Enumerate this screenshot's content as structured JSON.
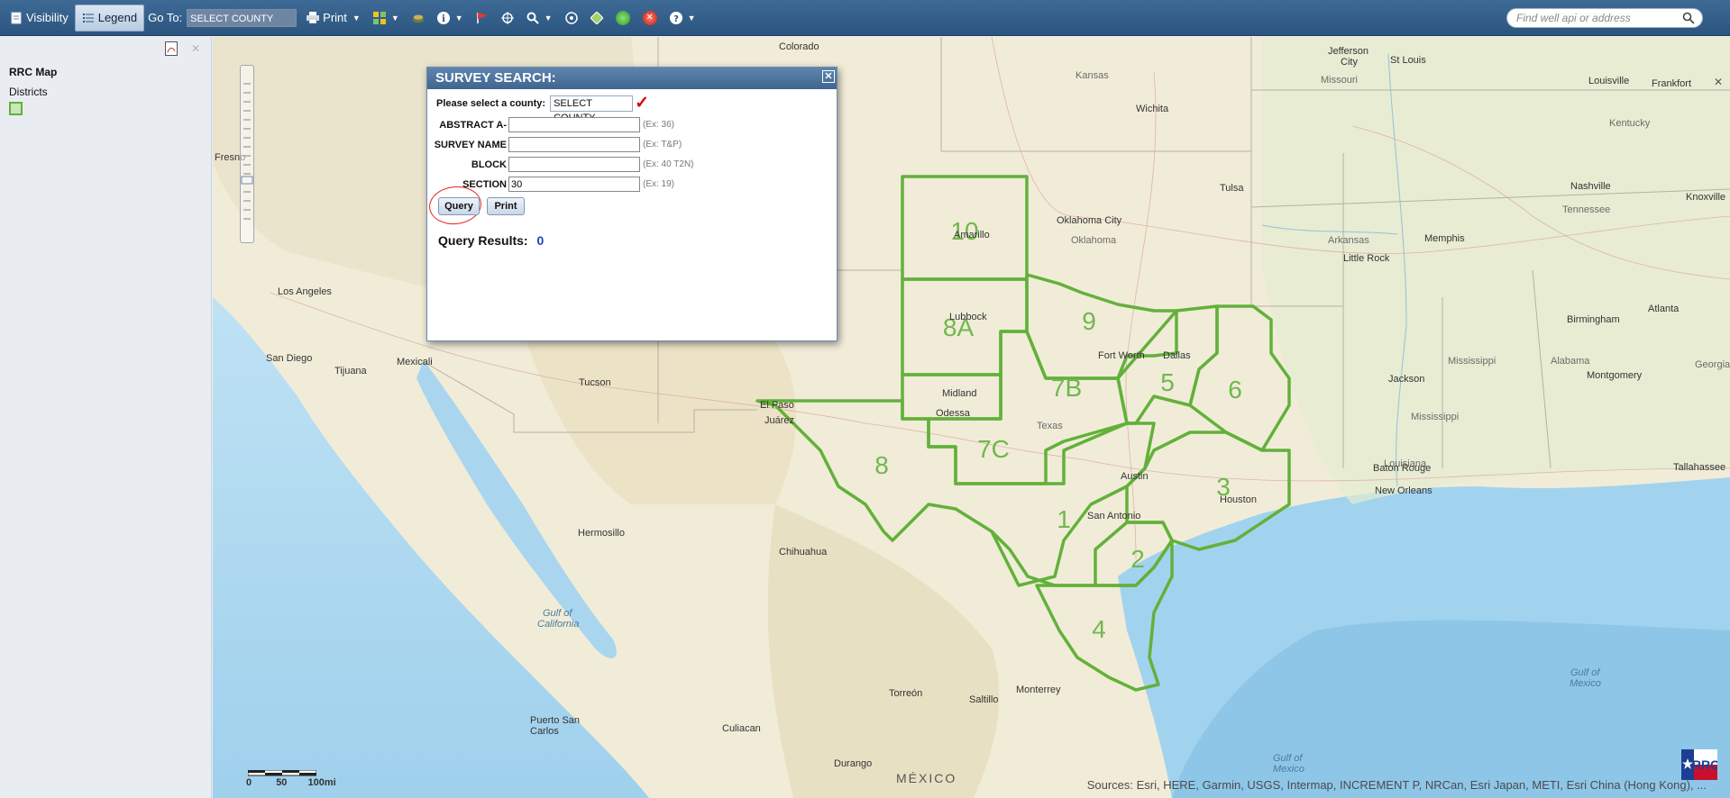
{
  "toolbar": {
    "visibility_label": "Visibility",
    "legend_label": "Legend",
    "goto_label": "Go To:",
    "goto_select": "SELECT COUNTY",
    "print_label": "Print",
    "search_placeholder": "Find well api or address"
  },
  "left_panel": {
    "title": "RRC Map",
    "layer_label": "Districts",
    "swatch_color": "#62b13a"
  },
  "dialog": {
    "title": "SURVEY SEARCH:",
    "county_prompt": "Please select a county:",
    "county_value": "SELECT COUNTY",
    "fields": [
      {
        "label": "ABSTRACT A-",
        "value": "",
        "example": "(Ex: 36)"
      },
      {
        "label": "SURVEY NAME",
        "value": "",
        "example": "(Ex: T&P)"
      },
      {
        "label": "BLOCK",
        "value": "",
        "example": "(Ex: 40 T2N)"
      },
      {
        "label": "SECTION",
        "value": "30",
        "example": "(Ex: 19)"
      }
    ],
    "query_label": "Query",
    "print_label": "Print",
    "results_label": "Query Results:",
    "results_count": "0"
  },
  "map": {
    "districts": [
      "10",
      "8A",
      "9",
      "5",
      "6",
      "7B",
      "7C",
      "8",
      "3",
      "1",
      "2",
      "4"
    ],
    "district_color": "#62b13a",
    "cities": [
      "Colorado",
      "Kansas",
      "Wichita",
      "Tulsa",
      "Oklahoma City",
      "Oklahoma",
      "Arkansas",
      "Little Rock",
      "Memphis",
      "Jefferson City",
      "St Louis",
      "Missouri",
      "Louisville",
      "Frankfort",
      "Kentucky",
      "Nashville",
      "Knoxville",
      "Tennessee",
      "Mississippi",
      "Jackson",
      "Alabama",
      "Birmingham",
      "Montgomery",
      "Atlanta",
      "Georgia",
      "Louisiana",
      "Baton Rouge",
      "New Orleans",
      "Tallahassee",
      "Houston",
      "Dallas",
      "Fort Worth",
      "Austin",
      "San Antonio",
      "Texas",
      "Midland",
      "Odessa",
      "El Paso",
      "Juárez",
      "Lubbock",
      "Amarillo",
      "Tucson",
      "Mexicali",
      "Tijuana",
      "San Diego",
      "Los Angeles",
      "Fresno",
      "Hermosillo",
      "Chihuahua",
      "Torreón",
      "Saltillo",
      "Monterrey",
      "Culiacan",
      "Durango",
      "Puerto San Carlos",
      "MÉXICO",
      "Gulf of California",
      "Gulf of Mexico"
    ],
    "scale_labels": [
      "0",
      "50",
      "100mi"
    ],
    "attribution": "Sources: Esri, HERE, Garmin, USGS, Intermap, INCREMENT P, NRCan, Esri Japan, METI, Esri China (Hong Kong), ...",
    "logo_text": "RRC"
  }
}
